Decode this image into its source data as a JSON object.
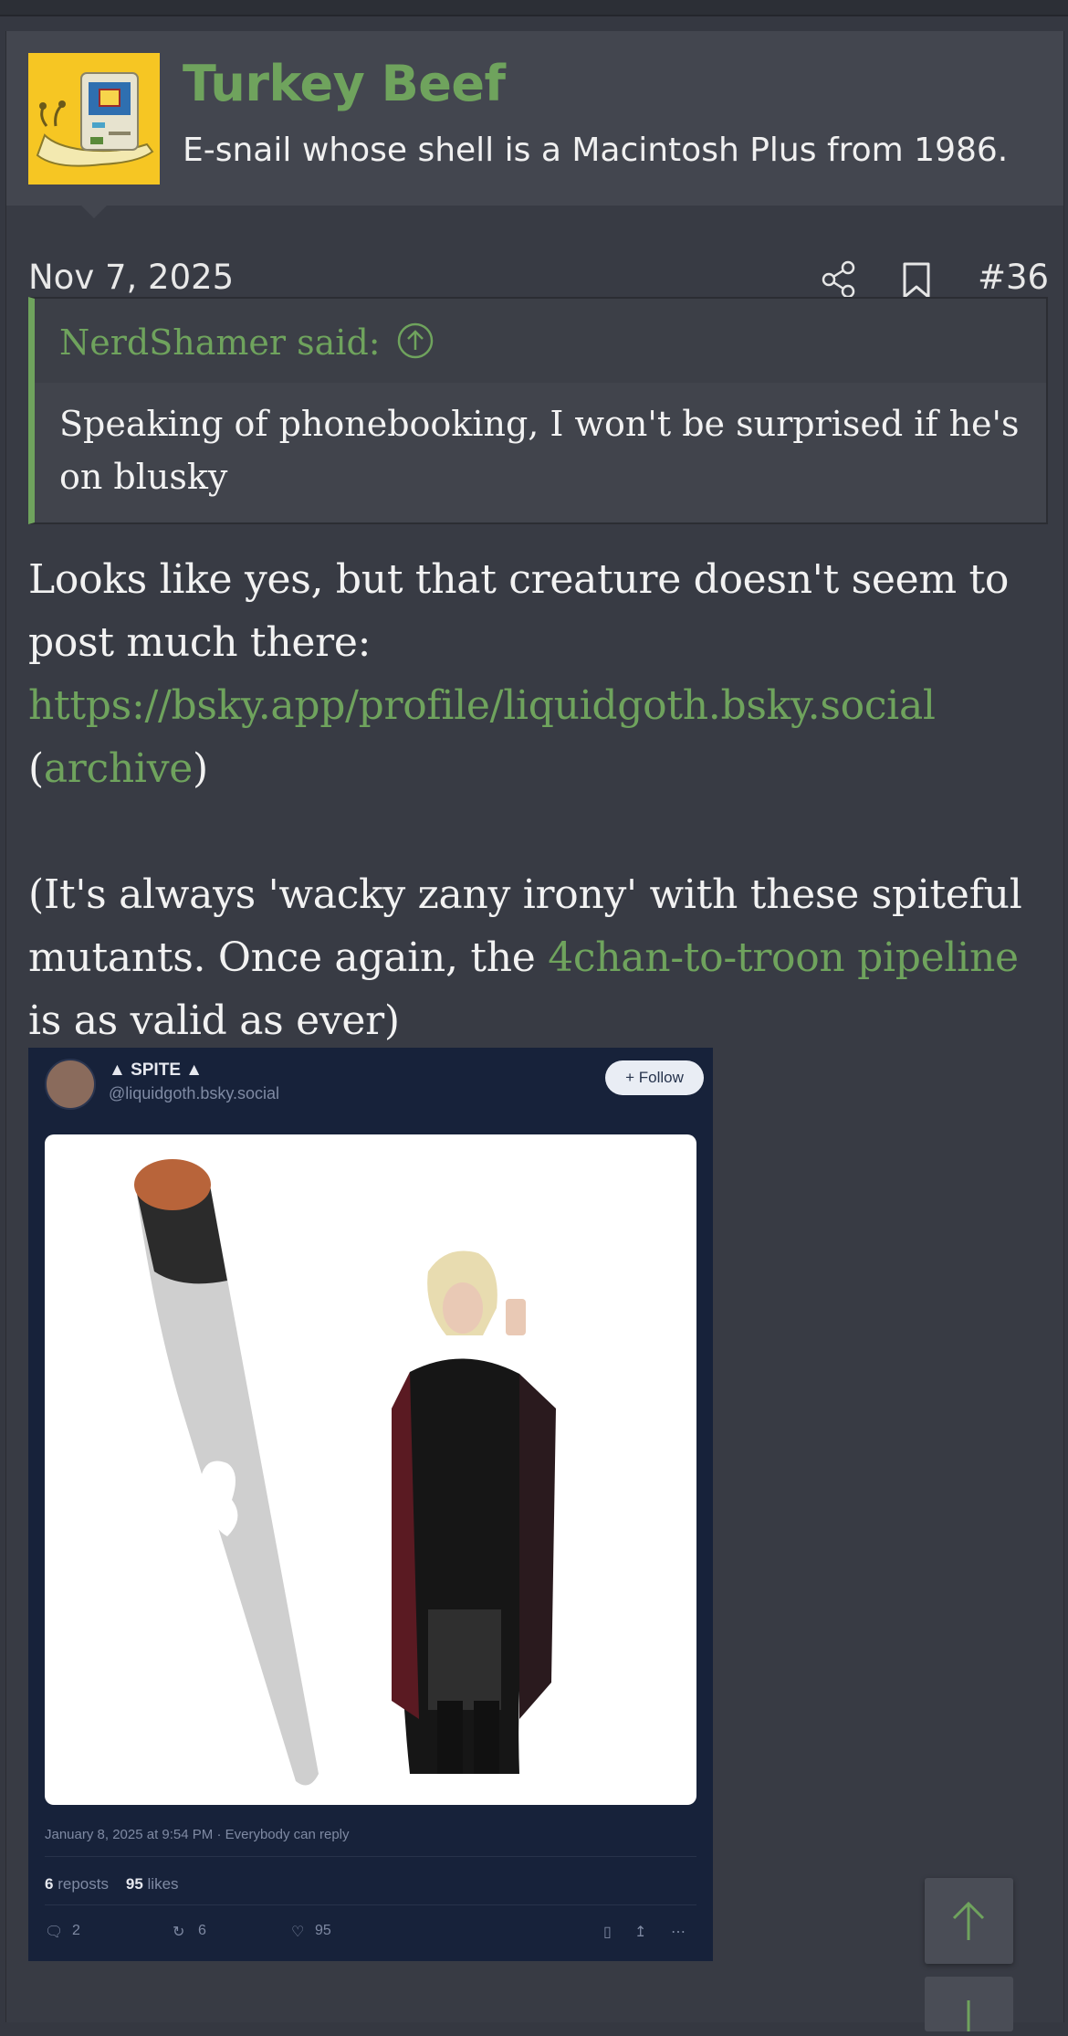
{
  "user": {
    "name": "Turkey Beef",
    "title": "E-snail whose shell is a Macintosh Plus from 1986."
  },
  "post": {
    "date": "Nov 7, 2025",
    "number": "#36"
  },
  "quote": {
    "author": "NerdShamer said:",
    "text": "Speaking of phonebooking, I won't be surprised if he's on blusky"
  },
  "body": {
    "line1": "Looks like yes, but that creature doesn't seem to post much there:",
    "link_profile": "https://bsky.app/profile/liquidgoth.bsky.social",
    "paren_open": "(",
    "link_archive": "archive",
    "paren_close": ")",
    "para2_start": "(It's always 'wacky zany irony' with these spiteful mutants. Once again, the ",
    "link_pipeline": "4chan-to-troon pipeline",
    "para2_end": " is as valid as ever)"
  },
  "embed": {
    "display_name": "▲ SPITE ▲",
    "handle": "@liquidgoth.bsky.social",
    "follow_label": "+ Follow",
    "timestamp": "January 8, 2025 at 9:54 PM · Everybody can reply",
    "reposts_count": "6",
    "reposts_label": "reposts",
    "likes_count": "95",
    "likes_label": "likes",
    "replies": "2",
    "reposts_action": "6",
    "likes_action": "95"
  },
  "colors": {
    "accent": "#6fa35d",
    "background": "#353841",
    "header": "#43464f"
  }
}
